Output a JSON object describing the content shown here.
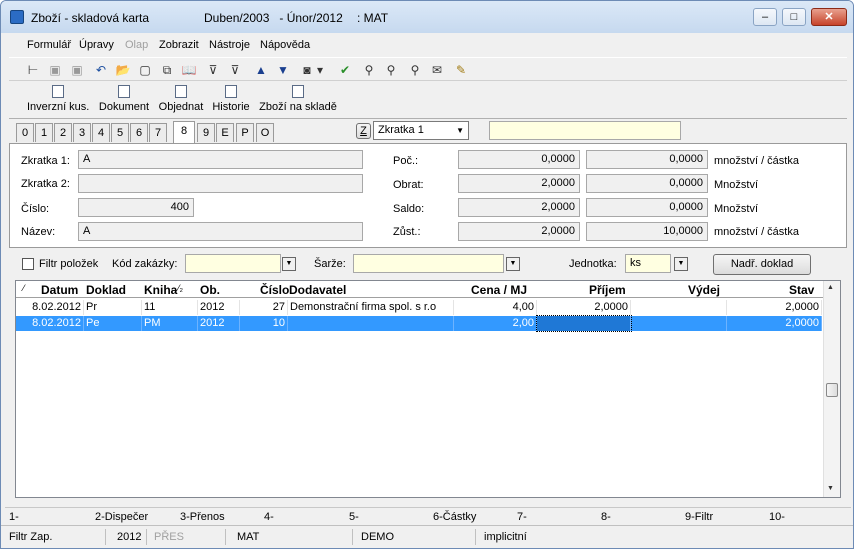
{
  "window": {
    "title": "Zboží - skladová karta",
    "period": "Duben/2003   - Únor/2012",
    "suffix": ": MAT",
    "minimize_glyph": "–",
    "maximize_glyph": "□",
    "close_glyph": "✕"
  },
  "menu": [
    "Formulář",
    "Úpravy",
    "Olap",
    "Zobrazit",
    "Nástroje",
    "Nápověda"
  ],
  "toolbar_icons": [
    "tree-icon",
    "save-icon",
    "save-as-icon",
    "undo-icon",
    "open-folder-icon",
    "new-doc-icon",
    "copy-icon",
    "book-icon",
    "filter-icon",
    "filter-edit-icon",
    "arrow-up-icon",
    "arrow-down-icon",
    "camera-icon",
    "dropdown-arrow-icon",
    "check-filter-icon",
    "binoculars-icon",
    "binoculars-next-icon",
    "binoculars-prev-icon",
    "mail-icon",
    "folder-edit-icon"
  ],
  "toolbar_glyphs": [
    "⊢",
    "▣",
    "▣",
    "↶",
    "📂",
    "▢",
    "⧉",
    "📖",
    "⊽",
    "⊽",
    "▲",
    "▼",
    "◙",
    "▾",
    "✔",
    "⚲",
    "⚲",
    "⚲",
    "✉",
    "✎"
  ],
  "toolbar2": [
    "Inverzní kus.",
    "Dokument",
    "Objednat",
    "Historie",
    "Zboží na skladě"
  ],
  "tabs": [
    "0",
    "1",
    "2",
    "3",
    "4",
    "5",
    "6",
    "7",
    "8",
    "9",
    "E",
    "P",
    "O"
  ],
  "active_tab": "8",
  "tab_selector": {
    "button": "Z",
    "select_value": "Zkratka 1"
  },
  "form": {
    "zkratka1_label": "Zkratka 1:",
    "zkratka1_value": "A",
    "zkratka2_label": "Zkratka 2:",
    "zkratka2_value": "",
    "cislo_label": "Číslo:",
    "cislo_value": "400",
    "nazev_label": "Název:",
    "nazev_value": "A"
  },
  "totals": [
    {
      "label": "Poč.:",
      "v1": "0,0000",
      "v2": "0,0000",
      "unit": "množství / částka"
    },
    {
      "label": "Obrat:",
      "v1": "2,0000",
      "v2": "0,0000",
      "unit": "Množství"
    },
    {
      "label": "Saldo:",
      "v1": "2,0000",
      "v2": "0,0000",
      "unit": "Množství"
    },
    {
      "label": "Zůst.:",
      "v1": "2,0000",
      "v2": "10,0000",
      "unit": "množství / částka"
    }
  ],
  "filter": {
    "filtr_label": "Filtr položek",
    "kod_label": "Kód zakázky:",
    "sarze_label": "Šarže:",
    "jednotka_label": "Jednotka:",
    "jednotka_value": "ks",
    "nadr_button": "Nadř. doklad"
  },
  "grid": {
    "headers": [
      "Datum",
      "Doklad",
      "Kniha",
      "Ob.",
      "Číslo",
      "Dodavatel",
      "Cena / MJ",
      "Příjem",
      "Výdej",
      "Stav"
    ],
    "sort_mark": "⁄",
    "sort_mark2": "⁄₂",
    "rows": [
      {
        "datum": "8.02.2012",
        "doklad": "Pr",
        "kniha": "11",
        "ob": "2012",
        "cislo": "27",
        "dodavatel": "Demonstrační firma spol. s r.o",
        "cena": "4,00",
        "prijem": "2,0000",
        "vydej": "",
        "stav": "2,0000"
      },
      {
        "datum": "8.02.2012",
        "doklad": "Pe",
        "kniha": "PM",
        "ob": "2012",
        "cislo": "10",
        "dodavatel": "",
        "cena": "2,00",
        "prijem": "",
        "vydej": "",
        "stav": "2,0000"
      }
    ]
  },
  "fkeys": [
    "1-",
    "2-Dispečer",
    "3-Přenos",
    "4-",
    "5-",
    "6-Částky",
    "7-",
    "8-",
    "9-Filtr",
    "10-"
  ],
  "status": [
    "Filtr Zap.",
    "2012",
    "PŘES",
    "MAT",
    "DEMO",
    "implicitní"
  ]
}
